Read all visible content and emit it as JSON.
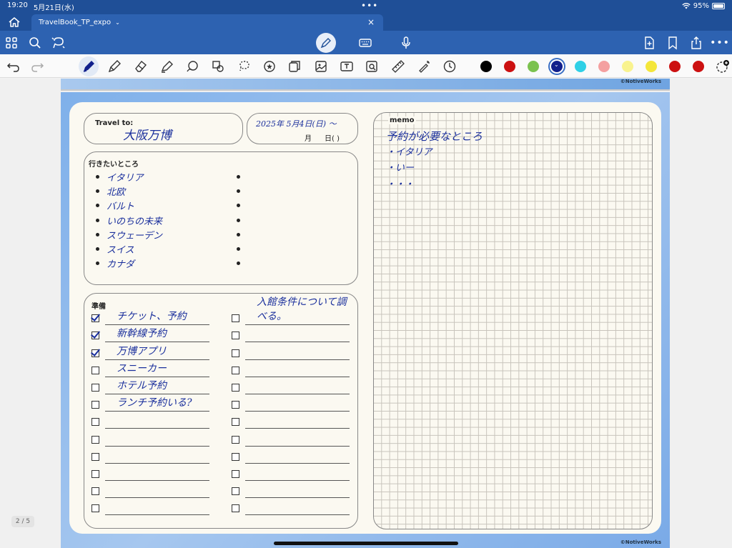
{
  "status": {
    "time": "19:20",
    "date": "5月21日(水)",
    "battery": "95%"
  },
  "tab": {
    "title": "TravelBook_TP_expo"
  },
  "toolbar": {
    "icons_left": [
      "grid-icon",
      "search-icon",
      "lasso-share-icon"
    ],
    "mode_icons": [
      "pen-mode-icon",
      "keyboard-icon",
      "microphone-icon"
    ],
    "icons_right": [
      "add-page-icon",
      "bookmark-icon",
      "share-icon",
      "more-icon"
    ]
  },
  "tools": [
    "undo-icon",
    "redo-icon",
    "pen-icon",
    "pencil-icon",
    "eraser-icon",
    "highlighter-icon",
    "shape-icon",
    "lasso-icon",
    "selection-icon",
    "sticker-icon",
    "element-icon",
    "image-icon",
    "text-box-icon",
    "camera-icon",
    "ruler-icon",
    "laser-pointer-icon",
    "timer-icon"
  ],
  "colors": [
    "#000000",
    "#cc1111",
    "#7bc24f",
    "#12208c",
    "#2fd0e6",
    "#f4a0a0",
    "#f9f38f",
    "#f4e63a",
    "#cc1111",
    "#cc1111"
  ],
  "selected_color_index": 3,
  "page": {
    "watermark": "©NotiveWorks",
    "counter": "2 / 5",
    "travel_to_label": "Travel to:",
    "travel_to_value": "大阪万博",
    "date_line1": "2025年 5月4日(日) 〜",
    "date_line2_month": "月",
    "date_line2_day": "日(  )",
    "places_label": "行きたいところ",
    "places": [
      "イタリア",
      "北欧",
      "バルト",
      "いのちの未来",
      "スウェーデン",
      "スイス",
      "カナダ"
    ],
    "places_right_count": 7,
    "prep_label": "準備",
    "prep_left": [
      {
        "text": "チケット、予約",
        "checked": true
      },
      {
        "text": "新幹線予約",
        "checked": true
      },
      {
        "text": "万博アプリ",
        "checked": true
      },
      {
        "text": "スニーカー",
        "checked": false
      },
      {
        "text": "ホテル予約",
        "checked": false
      },
      {
        "text": "ランチ予約いる?",
        "checked": false
      },
      {
        "text": "",
        "checked": false
      },
      {
        "text": "",
        "checked": false
      },
      {
        "text": "",
        "checked": false
      },
      {
        "text": "",
        "checked": false
      },
      {
        "text": "",
        "checked": false
      },
      {
        "text": "",
        "checked": false
      }
    ],
    "prep_right": [
      {
        "text": "入館条件について調べる。",
        "checked": false
      },
      {
        "text": "",
        "checked": false
      },
      {
        "text": "",
        "checked": false
      },
      {
        "text": "",
        "checked": false
      },
      {
        "text": "",
        "checked": false
      },
      {
        "text": "",
        "checked": false
      },
      {
        "text": "",
        "checked": false
      },
      {
        "text": "",
        "checked": false
      },
      {
        "text": "",
        "checked": false
      },
      {
        "text": "",
        "checked": false
      },
      {
        "text": "",
        "checked": false
      },
      {
        "text": "",
        "checked": false
      }
    ],
    "memo_label": "memo",
    "memo_lines": [
      "予約が必要なところ",
      "・イタリア",
      "・いー",
      "・・・"
    ]
  }
}
